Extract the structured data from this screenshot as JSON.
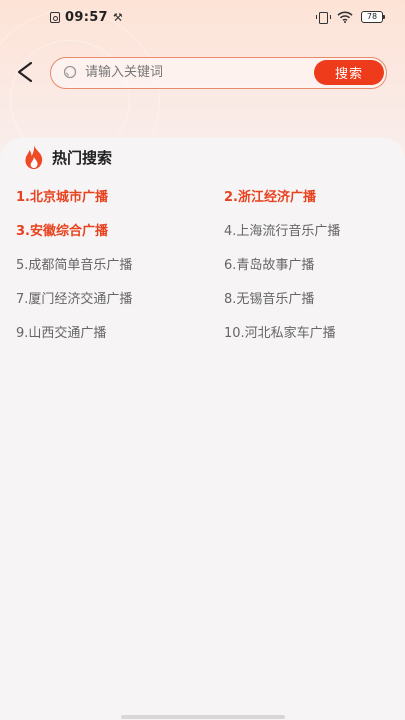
{
  "status_bar": {
    "time": "09:57",
    "battery": "78",
    "icons": [
      "screenshot-icon",
      "tools-icon",
      "vibrate-icon",
      "wifi-icon",
      "battery-icon"
    ]
  },
  "header": {
    "back_icon": "chevron-left-icon",
    "search": {
      "placeholder": "请输入关键词",
      "value": "",
      "button_label": "搜索"
    }
  },
  "hot_search": {
    "title": "热门搜索",
    "icon": "flame-icon",
    "accent_color": "#e9421f",
    "items": [
      {
        "label": "1.北京城市广播",
        "highlight": true
      },
      {
        "label": "2.浙江经济广播",
        "highlight": true
      },
      {
        "label": "3.安徽综合广播",
        "highlight": true
      },
      {
        "label": "4.上海流行音乐广播",
        "highlight": false
      },
      {
        "label": "5.成都简单音乐广播",
        "highlight": false
      },
      {
        "label": "6.青岛故事广播",
        "highlight": false
      },
      {
        "label": "7.厦门经济交通广播",
        "highlight": false
      },
      {
        "label": "8.无锡音乐广播",
        "highlight": false
      },
      {
        "label": "9.山西交通广播",
        "highlight": false
      },
      {
        "label": "10.河北私家车广播",
        "highlight": false
      }
    ]
  }
}
